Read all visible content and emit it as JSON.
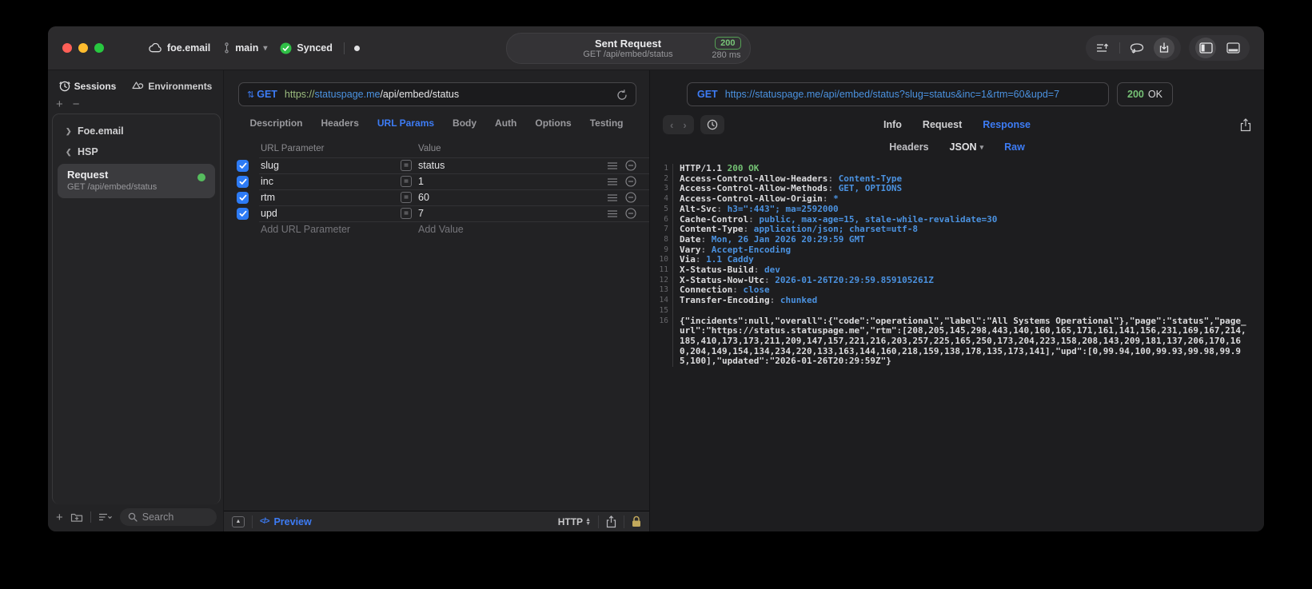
{
  "titlebar": {
    "project": "foe.email",
    "branch": "main",
    "sync_status": "Synced",
    "center": {
      "title": "Sent Request",
      "status_code": "200",
      "subtitle": "GET /api/embed/status",
      "duration": "280 ms"
    }
  },
  "sidebar": {
    "tabs": {
      "sessions": "Sessions",
      "environments": "Environments"
    },
    "tree": [
      {
        "label": "Foe.email",
        "state": "collapsed"
      },
      {
        "label": "HSP",
        "state": "expanded"
      }
    ],
    "selected_request": {
      "name": "Request",
      "subtitle": "GET /api/embed/status"
    },
    "search_placeholder": "Search"
  },
  "request_editor": {
    "method": "GET",
    "url_scheme": "https://",
    "url_host": "statuspage.me",
    "url_path": "/api/embed/status",
    "tabs": [
      "Description",
      "Headers",
      "URL Params",
      "Body",
      "Auth",
      "Options",
      "Testing"
    ],
    "active_tab": "URL Params",
    "params": {
      "columns": {
        "name": "URL Parameter",
        "value": "Value"
      },
      "rows": [
        {
          "name": "slug",
          "value": "status",
          "enabled": true
        },
        {
          "name": "inc",
          "value": "1",
          "enabled": true
        },
        {
          "name": "rtm",
          "value": "60",
          "enabled": true
        },
        {
          "name": "upd",
          "value": "7",
          "enabled": true
        }
      ],
      "add_name_placeholder": "Add URL Parameter",
      "add_value_placeholder": "Add Value"
    },
    "footer": {
      "preview_label": "Preview",
      "code_glyph": "</>",
      "protocol": "HTTP"
    }
  },
  "response_pane": {
    "request_line": {
      "method": "GET",
      "url": "https://statuspage.me/api/embed/status?slug=status&inc=1&rtm=60&upd=7"
    },
    "status": {
      "code": "200",
      "text": "OK"
    },
    "tabs": [
      "Info",
      "Request",
      "Response"
    ],
    "active_tab": "Response",
    "subtabs": [
      "Headers",
      "JSON",
      "Raw"
    ],
    "active_subtab": "Raw",
    "body_lines": [
      {
        "n": 1,
        "parts": [
          [
            "HTTP/1.1 ",
            "w"
          ],
          [
            "200 OK",
            "g"
          ]
        ]
      },
      {
        "n": 2,
        "parts": [
          [
            "Access-Control-Allow-Headers",
            "w"
          ],
          [
            ": ",
            "d"
          ],
          [
            "Content-Type",
            "b"
          ]
        ]
      },
      {
        "n": 3,
        "parts": [
          [
            "Access-Control-Allow-Methods",
            "w"
          ],
          [
            ": ",
            "d"
          ],
          [
            "GET, OPTIONS",
            "b"
          ]
        ]
      },
      {
        "n": 4,
        "parts": [
          [
            "Access-Control-Allow-Origin",
            "w"
          ],
          [
            ": ",
            "d"
          ],
          [
            "*",
            "b"
          ]
        ]
      },
      {
        "n": 5,
        "parts": [
          [
            "Alt-Svc",
            "w"
          ],
          [
            ": ",
            "d"
          ],
          [
            "h3=\":443\"; ma=2592000",
            "b"
          ]
        ]
      },
      {
        "n": 6,
        "parts": [
          [
            "Cache-Control",
            "w"
          ],
          [
            ": ",
            "d"
          ],
          [
            "public, max-age=15, stale-while-revalidate=30",
            "b"
          ]
        ]
      },
      {
        "n": 7,
        "parts": [
          [
            "Content-Type",
            "w"
          ],
          [
            ": ",
            "d"
          ],
          [
            "application/json; charset=utf-8",
            "b"
          ]
        ]
      },
      {
        "n": 8,
        "parts": [
          [
            "Date",
            "w"
          ],
          [
            ": ",
            "d"
          ],
          [
            "Mon, 26 Jan 2026 20:29:59 GMT",
            "b"
          ]
        ]
      },
      {
        "n": 9,
        "parts": [
          [
            "Vary",
            "w"
          ],
          [
            ": ",
            "d"
          ],
          [
            "Accept-Encoding",
            "b"
          ]
        ]
      },
      {
        "n": 10,
        "parts": [
          [
            "Via",
            "w"
          ],
          [
            ": ",
            "d"
          ],
          [
            "1.1 Caddy",
            "b"
          ]
        ]
      },
      {
        "n": 11,
        "parts": [
          [
            "X-Status-Build",
            "w"
          ],
          [
            ": ",
            "d"
          ],
          [
            "dev",
            "b"
          ]
        ]
      },
      {
        "n": 12,
        "parts": [
          [
            "X-Status-Now-Utc",
            "w"
          ],
          [
            ": ",
            "d"
          ],
          [
            "2026-01-26T20:29:59.859105261Z",
            "b"
          ]
        ]
      },
      {
        "n": 13,
        "parts": [
          [
            "Connection",
            "w"
          ],
          [
            ": ",
            "d"
          ],
          [
            "close",
            "b"
          ]
        ]
      },
      {
        "n": 14,
        "parts": [
          [
            "Transfer-Encoding",
            "w"
          ],
          [
            ": ",
            "d"
          ],
          [
            "chunked",
            "b"
          ]
        ]
      },
      {
        "n": 15,
        "parts": []
      },
      {
        "n": 16,
        "parts": [
          [
            "{\"incidents\":null,\"overall\":{\"code\":\"operational\",\"label\":\"All Systems Operational\"},\"page\":\"status\",\"page_url\":\"https://status.statuspage.me\",\"rtm\":[208,205,145,298,443,140,160,165,171,161,141,156,231,169,167,214,185,410,173,173,211,209,147,157,221,216,203,257,225,165,250,173,204,223,158,208,143,209,181,137,206,170,160,204,149,154,134,234,220,133,163,144,160,218,159,138,178,135,173,141],\"upd\":[0,99.94,100,99.93,99.98,99.95,100],\"updated\":\"2026-01-26T20:29:59Z\"}",
            "w"
          ]
        ]
      }
    ]
  },
  "colors": {
    "accent_blue": "#3d7cf5",
    "code_blue": "#4b92e0",
    "status_green": "#76c276",
    "scheme_green": "#9dbd7f",
    "badge_green_border": "#55a055"
  }
}
